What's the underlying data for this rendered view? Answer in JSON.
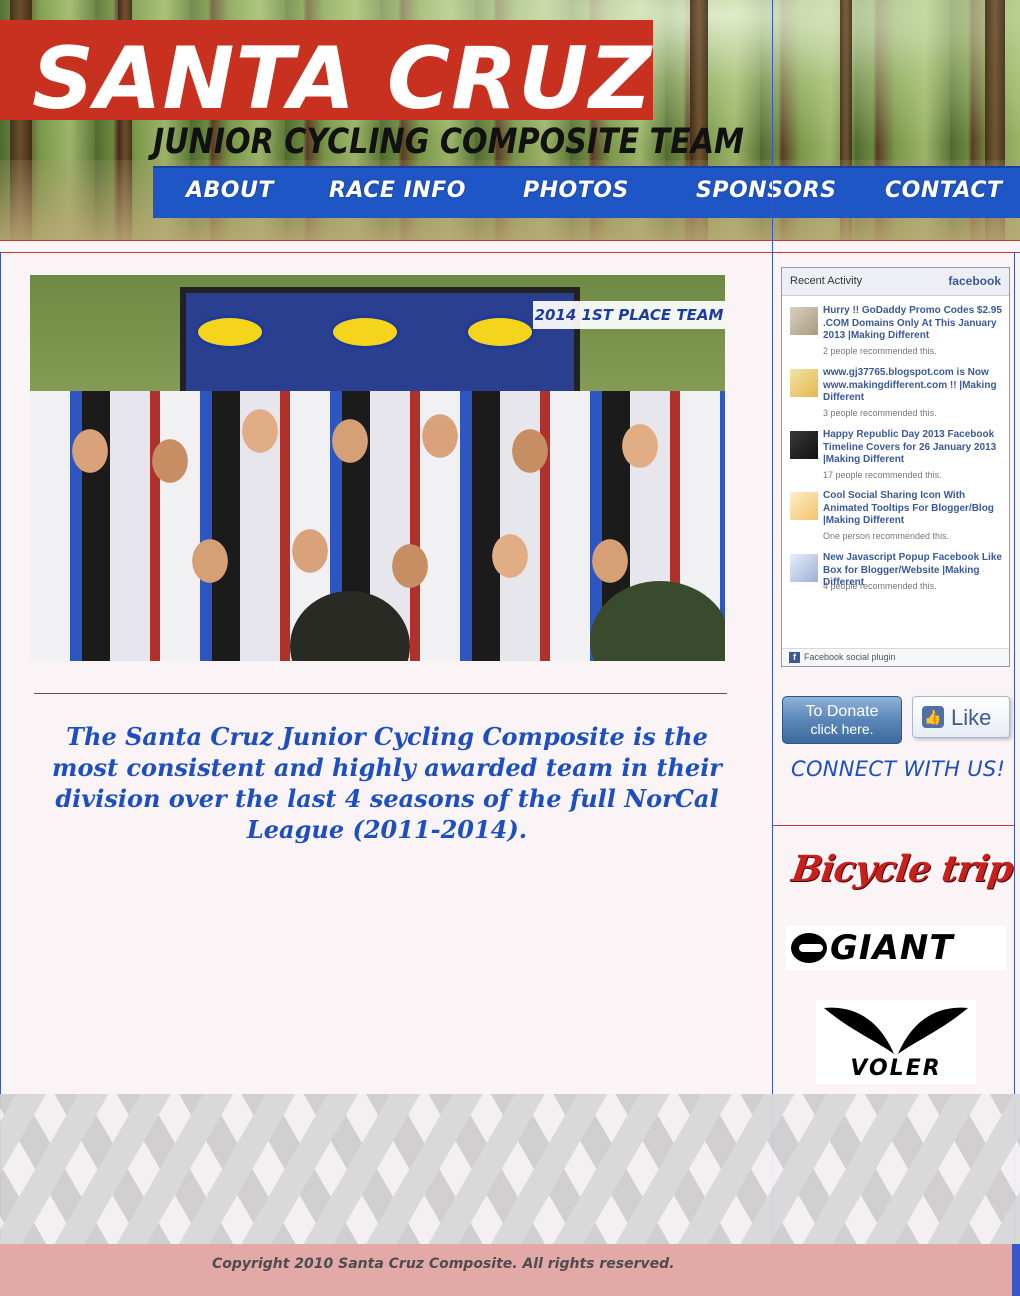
{
  "header": {
    "title": "SANTA CRUZ",
    "subtitle": "JUNIOR CYCLING COMPOSITE TEAM"
  },
  "nav": {
    "items": [
      "ABOUT",
      "RACE INFO",
      "PHOTOS",
      "SPONSORS",
      "CONTACT"
    ]
  },
  "main": {
    "photo_caption": "2014 1ST PLACE TEAM",
    "mission": "The Santa Cruz Junior Cycling Composite is the most consistent and highly awarded team in their division over the last 4 seasons of the full NorCal League (2011-2014)."
  },
  "facebook": {
    "header_title": "Recent Activity",
    "header_logo": "facebook",
    "items": [
      {
        "title": "Hurry !! GoDaddy Promo Codes $2.95 .COM Domains Only At This January 2013 |Making Different",
        "meta": "2 people recommended this."
      },
      {
        "title": "www.gj37765.blogspot.com is Now www.makingdifferent.com !! |Making Different",
        "meta": "3 people recommended this."
      },
      {
        "title": "Happy Republic Day 2013 Facebook Timeline Covers for 26 January 2013 |Making Different",
        "meta": "17 people recommended this."
      },
      {
        "title": "Cool Social Sharing Icon With Animated Tooltips For Blogger/Blog |Making Different",
        "meta": "One person recommended this."
      },
      {
        "title": "New Javascript Popup Facebook Like Box for Blogger/Website |Making Different",
        "meta": "4 people recommended this."
      }
    ],
    "footer": "Facebook social plugin"
  },
  "sidebar": {
    "donate_line1": "To Donate",
    "donate_line2": "click here.",
    "like_label": "Like",
    "connect": "CONNECT WITH US!"
  },
  "sponsors": {
    "bicycle_trip": "Bicycle trip",
    "giant": "GIANT",
    "voler": "VOLER"
  },
  "footer": {
    "copyright": "Copyright 2010 Santa Cruz Composite. All rights reserved."
  },
  "colors": {
    "brand_red": "#c8301f",
    "nav_blue": "#1f56c6",
    "text_blue": "#1d4fc0",
    "footer_pink": "#e3a9a6"
  }
}
